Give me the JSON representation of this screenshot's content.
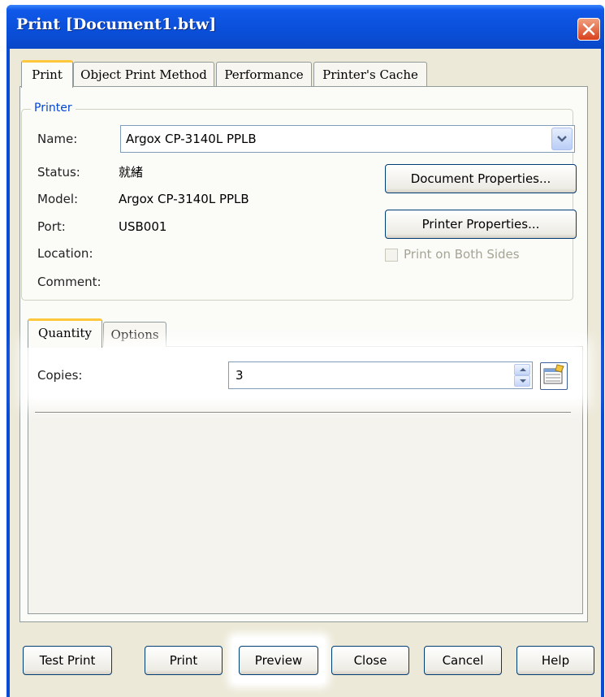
{
  "window": {
    "title": "Print [Document1.btw]"
  },
  "tabs": [
    {
      "label": "Print",
      "active": true
    },
    {
      "label": "Object Print Method",
      "active": false
    },
    {
      "label": "Performance",
      "active": false
    },
    {
      "label": "Printer's Cache",
      "active": false
    }
  ],
  "printer": {
    "group_label": "Printer",
    "name_label": "Name:",
    "name_value": "Argox CP-3140L PPLB",
    "status_label": "Status:",
    "status_value": "就緒",
    "model_label": "Model:",
    "model_value": "Argox CP-3140L PPLB",
    "port_label": "Port:",
    "port_value": "USB001",
    "location_label": "Location:",
    "comment_label": "Comment:",
    "document_properties_label": "Document Properties...",
    "printer_properties_label": "Printer Properties...",
    "print_both_sides_label": "Print on Both Sides"
  },
  "subtabs": [
    {
      "label": "Quantity",
      "active": true
    },
    {
      "label": "Options",
      "active": false
    }
  ],
  "quantity": {
    "copies_label": "Copies:",
    "copies_value": "3"
  },
  "buttons": {
    "test_print": "Test Print",
    "print": "Print",
    "preview": "Preview",
    "close": "Close",
    "cancel": "Cancel",
    "help": "Help"
  },
  "colors": {
    "titlebar": "#0a4fd9",
    "dialog_bg": "#ece9d8",
    "active_tab_accent": "#ffc83c",
    "group_label": "#0046d5"
  },
  "icons": {
    "close": "close-x-icon",
    "dropdown": "chevron-down-icon",
    "spinner": "spin-arrows-icon",
    "data_source": "database-table-icon"
  }
}
